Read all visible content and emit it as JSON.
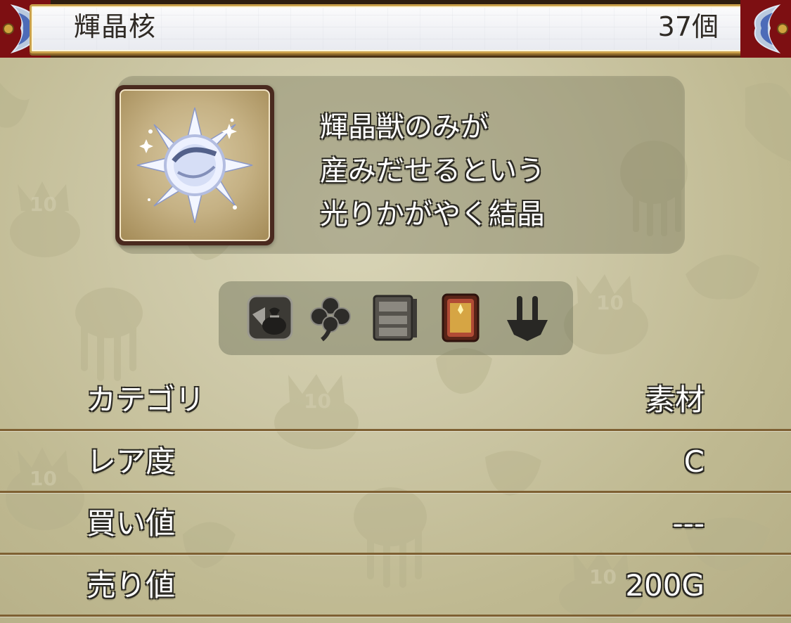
{
  "item": {
    "name": "輝晶核",
    "count": "37個",
    "icon": "crystal-core-icon",
    "description": [
      "輝晶獣のみが",
      "産みだせるという",
      "光りかがやく結晶"
    ]
  },
  "property_icons": [
    {
      "name": "trade-bag-icon",
      "label": ""
    },
    {
      "name": "clover-icon",
      "label": ""
    },
    {
      "name": "storage-cabinet-icon",
      "label": ""
    },
    {
      "name": "recipe-book-icon",
      "label": ""
    },
    {
      "name": "forge-tool-icon",
      "label": ""
    }
  ],
  "stats": [
    {
      "label": "カテゴリ",
      "value": "素材"
    },
    {
      "label": "レア度",
      "value": "C"
    },
    {
      "label": "買い値",
      "value": "---"
    },
    {
      "label": "売り値",
      "value": "200G"
    }
  ],
  "colors": {
    "background": "#cdc8a7",
    "header_plate": "#f4f5f8",
    "header_gold": "#caa14b",
    "divider": "#7e6032",
    "panel": "#696950",
    "text": "#ffffff"
  }
}
